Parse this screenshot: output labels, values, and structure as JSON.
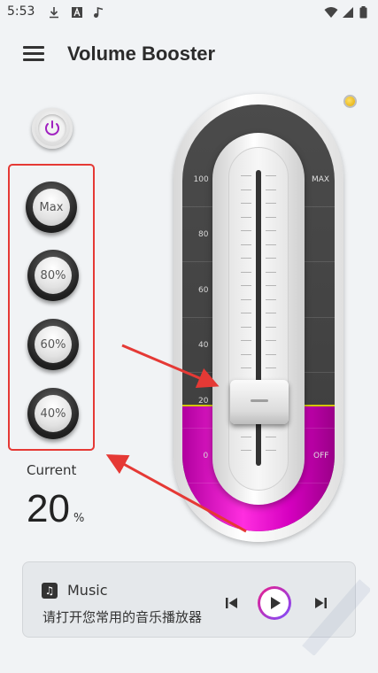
{
  "status_bar": {
    "time": "5:53",
    "icons": [
      "download-icon",
      "font-a-icon",
      "music-note-icon",
      "wifi-icon",
      "signal-icon",
      "battery-icon"
    ]
  },
  "app_bar": {
    "title": "Volume Booster",
    "menu_icon": "hamburger-menu-icon"
  },
  "power": {
    "icon": "power-icon",
    "color": "#a020c0"
  },
  "presets": [
    {
      "label": "Max"
    },
    {
      "label": "80%"
    },
    {
      "label": "60%"
    },
    {
      "label": "40%"
    }
  ],
  "current": {
    "label": "Current",
    "value": "20",
    "unit": "%"
  },
  "meter": {
    "scale": [
      "100",
      "80",
      "60",
      "40",
      "20",
      "0"
    ],
    "max_label": "MAX",
    "off_label": "OFF",
    "level_fraction": 0.2,
    "fill_color": "#e800c8",
    "level_line_color": "#d4c400"
  },
  "player": {
    "title": "Music",
    "subtitle": "请打开您常用的音乐播放器",
    "icons": [
      "music-note-icon",
      "skip-previous-icon",
      "play-icon",
      "skip-next-icon"
    ]
  },
  "colors": {
    "background": "#f1f3f5",
    "highlight_box": "#e53935",
    "accent": "#a020c0"
  }
}
